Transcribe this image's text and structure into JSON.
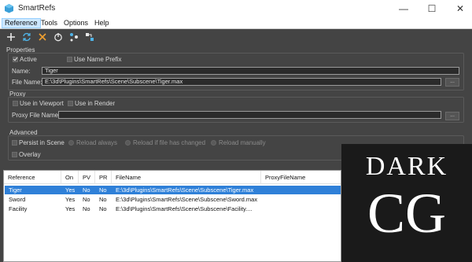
{
  "window": {
    "title": "SmartRefs",
    "minimize": "—",
    "maximize": "☐",
    "close": "✕"
  },
  "menu": [
    "Reference",
    "Tools",
    "Options",
    "Help"
  ],
  "toolbar": [
    "add-icon",
    "refresh-icon",
    "remove-icon",
    "power-icon",
    "merge-icon",
    "replace-icon"
  ],
  "properties": {
    "title": "Properties",
    "active_label": "Active",
    "active_checked": true,
    "use_name_prefix_label": "Use Name Prefix",
    "use_name_prefix_checked": false,
    "name_label": "Name:",
    "name_value": "Tiger",
    "filename_label": "File Name:",
    "filename_value": "E:\\3d\\Plugins\\SmartRefs\\Scene\\Subscene\\Tiger.max",
    "browse_label": "..."
  },
  "proxy": {
    "title": "Proxy",
    "use_in_viewport_label": "Use in Viewport",
    "use_in_render_label": "Use in Render",
    "proxy_file_label": "Proxy File Name:",
    "proxy_file_value": "",
    "browse_label": "..."
  },
  "advanced": {
    "title": "Advanced",
    "persist_label": "Persist in Scene",
    "overlay_label": "Overlay",
    "reload_options": [
      "Reload always",
      "Reload if file has changed",
      "Reload manually"
    ]
  },
  "table": {
    "columns": [
      "Reference",
      "On",
      "PV",
      "PR",
      "FileName",
      "ProxyFileName"
    ],
    "rows": [
      [
        "Tiger",
        "Yes",
        "No",
        "No",
        "E:\\3d\\Plugins\\SmartRefs\\Scene\\Subscene\\Tiger.max",
        ""
      ],
      [
        "Sword",
        "Yes",
        "No",
        "No",
        "E:\\3d\\Plugins\\SmartRefs\\Scene\\Subscene\\Sword.max",
        ""
      ],
      [
        "Facility",
        "Yes",
        "No",
        "No",
        "E:\\3d\\Plugins\\SmartRefs\\Scene\\Subscene\\Facility....",
        ""
      ]
    ],
    "selected_row": 0
  },
  "watermark": {
    "line1": "DARK",
    "line2": "CG"
  }
}
